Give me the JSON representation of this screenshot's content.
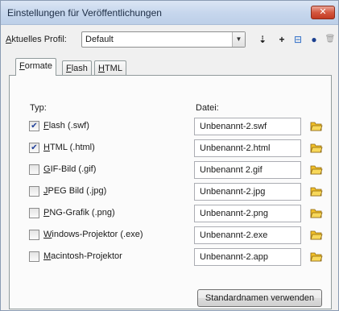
{
  "window": {
    "title": "Einstellungen für Veröffentlichungen",
    "close_glyph": "✕"
  },
  "profile": {
    "label_u": "A",
    "label_rest": "ktuelles Profil:",
    "selected": "Default",
    "arrow": "▼",
    "toolbar": [
      {
        "name": "duplicate-profile-button",
        "glyph": "⇣"
      },
      {
        "name": "add-profile-button",
        "glyph": "+"
      },
      {
        "name": "import-export-button",
        "glyph": "⊟"
      },
      {
        "name": "profile-info-button",
        "glyph": "●"
      },
      {
        "name": "delete-profile-button",
        "glyph": "🗑"
      }
    ]
  },
  "tabs": [
    {
      "label_u": "F",
      "label_rest": "ormate"
    },
    {
      "label_u": "F",
      "label_rest": "lash"
    },
    {
      "label_u": "H",
      "label_rest": "TML"
    }
  ],
  "columns": {
    "type": "Typ:",
    "file": "Datei:"
  },
  "formats": [
    {
      "label_pre": "",
      "label_u": "F",
      "label_rest": "lash  (.swf)",
      "checked": true,
      "check_glyph": "✔",
      "file": "Unbenannt-2.swf"
    },
    {
      "label_pre": "",
      "label_u": "H",
      "label_rest": "TML  (.html)",
      "checked": true,
      "check_glyph": "✔",
      "file": "Unbenannt-2.html"
    },
    {
      "label_pre": "",
      "label_u": "G",
      "label_rest": "IF-Bild  (.gif)",
      "checked": false,
      "check_glyph": "",
      "file": "Unbenannt 2.gif"
    },
    {
      "label_pre": "",
      "label_u": "J",
      "label_rest": "PEG Bild  (.jpg)",
      "checked": false,
      "check_glyph": "",
      "file": "Unbenannt-2.jpg"
    },
    {
      "label_pre": "",
      "label_u": "P",
      "label_rest": "NG-Grafik  (.png)",
      "checked": false,
      "check_glyph": "",
      "file": "Unbenannt-2.png"
    },
    {
      "label_pre": "",
      "label_u": "W",
      "label_rest": "indows-Projektor  (.exe)",
      "checked": false,
      "check_glyph": "",
      "file": "Unbenannt-2.exe"
    },
    {
      "label_pre": "",
      "label_u": "M",
      "label_rest": "acintosh-Projektor",
      "checked": false,
      "check_glyph": "",
      "file": "Unbenannt-2.app"
    }
  ],
  "default_names_button": "Standardnamen verwenden",
  "colors": {
    "folder": "#f2c028",
    "title_bg": "#c7d7ed",
    "close": "#d4573f"
  }
}
